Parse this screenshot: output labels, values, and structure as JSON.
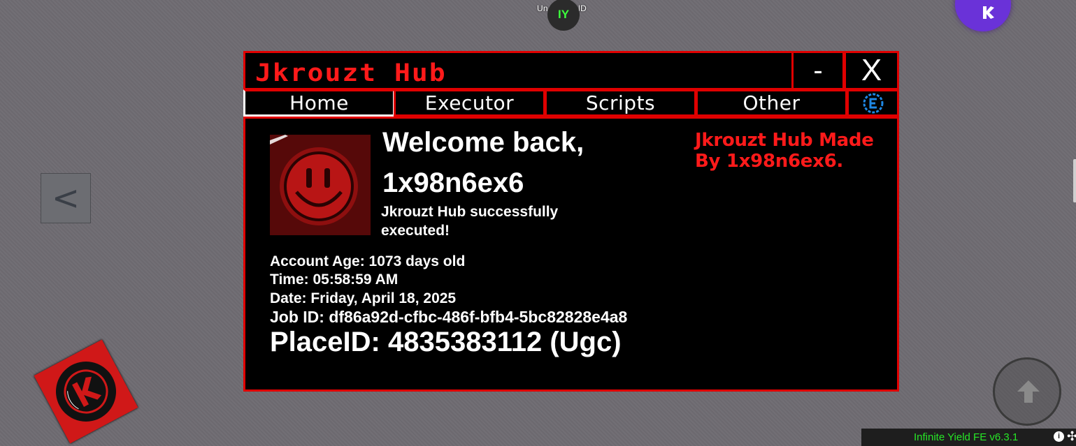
{
  "game_overlay": {
    "name_tag": "Un 4RW1ND",
    "iy_button_label": "IY",
    "back_button_label": "<",
    "colors": {
      "background": "#6f6c72",
      "iy_green": "#27e627",
      "kohl_purple": "#6a32d8"
    }
  },
  "infinite_yield": {
    "version_label": "Infinite Yield FE v6.3.1",
    "info_icon": "i"
  },
  "hub": {
    "title": "Jkrouzt Hub",
    "minimize_label": "-",
    "close_label": "X",
    "tabs": [
      {
        "label": "Home",
        "active": true
      },
      {
        "label": "Executor"
      },
      {
        "label": "Scripts"
      },
      {
        "label": "Other"
      }
    ],
    "settings_icon": "cheat-engine-icon",
    "colors": {
      "accent": "#e00000",
      "title": "#ff1a1a",
      "panel": "#000000",
      "text": "#ffffff"
    },
    "home": {
      "welcome": "Welcome back,",
      "username": "1x98n6ex6",
      "status": "Jkrouzt Hub successfully executed!",
      "credit": "Jkrouzt Hub Made By 1x98n6ex6.",
      "account_age": "Account Age: 1073 days old",
      "time": "Time: 05:58:59 AM",
      "date": "Date: Friday, April 18, 2025",
      "job_id": "Job ID: df86a92d-cfbc-486f-bfb4-5bc82828e4a8",
      "place_id": "PlaceID: 4835383112 (Ugc)"
    }
  }
}
